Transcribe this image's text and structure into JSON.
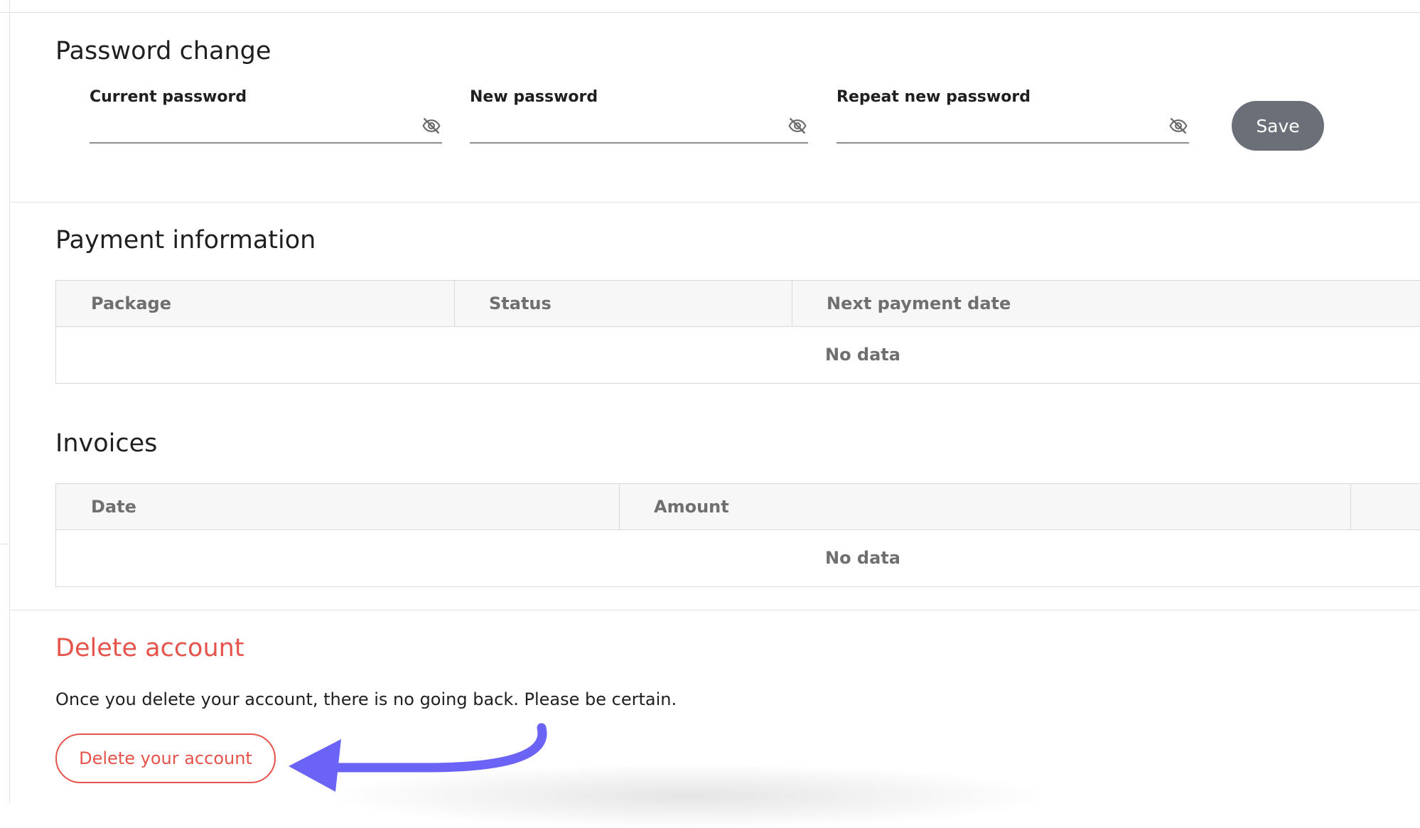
{
  "password_change": {
    "title": "Password change",
    "fields": [
      {
        "label": "Current password",
        "value": ""
      },
      {
        "label": "New password",
        "value": ""
      },
      {
        "label": "Repeat new password",
        "value": ""
      }
    ],
    "save_label": "Save"
  },
  "payment_information": {
    "title": "Payment information",
    "columns": [
      "Package",
      "Status",
      "Next payment date"
    ],
    "empty_text": "No data"
  },
  "invoices": {
    "title": "Invoices",
    "columns": [
      "Date",
      "Amount"
    ],
    "empty_text": "No data"
  },
  "delete_account": {
    "title": "Delete account",
    "description": "Once you delete your account, there is no going back. Please be certain.",
    "button_label": "Delete your account"
  },
  "colors": {
    "danger": "#e5534b",
    "save_button": "#6b7078",
    "arrow": "#6b63f6",
    "table_header_bg": "#f7f7f7"
  },
  "icons": {
    "password_toggle": "eye-off-icon",
    "annotation": "curved-arrow-icon"
  }
}
